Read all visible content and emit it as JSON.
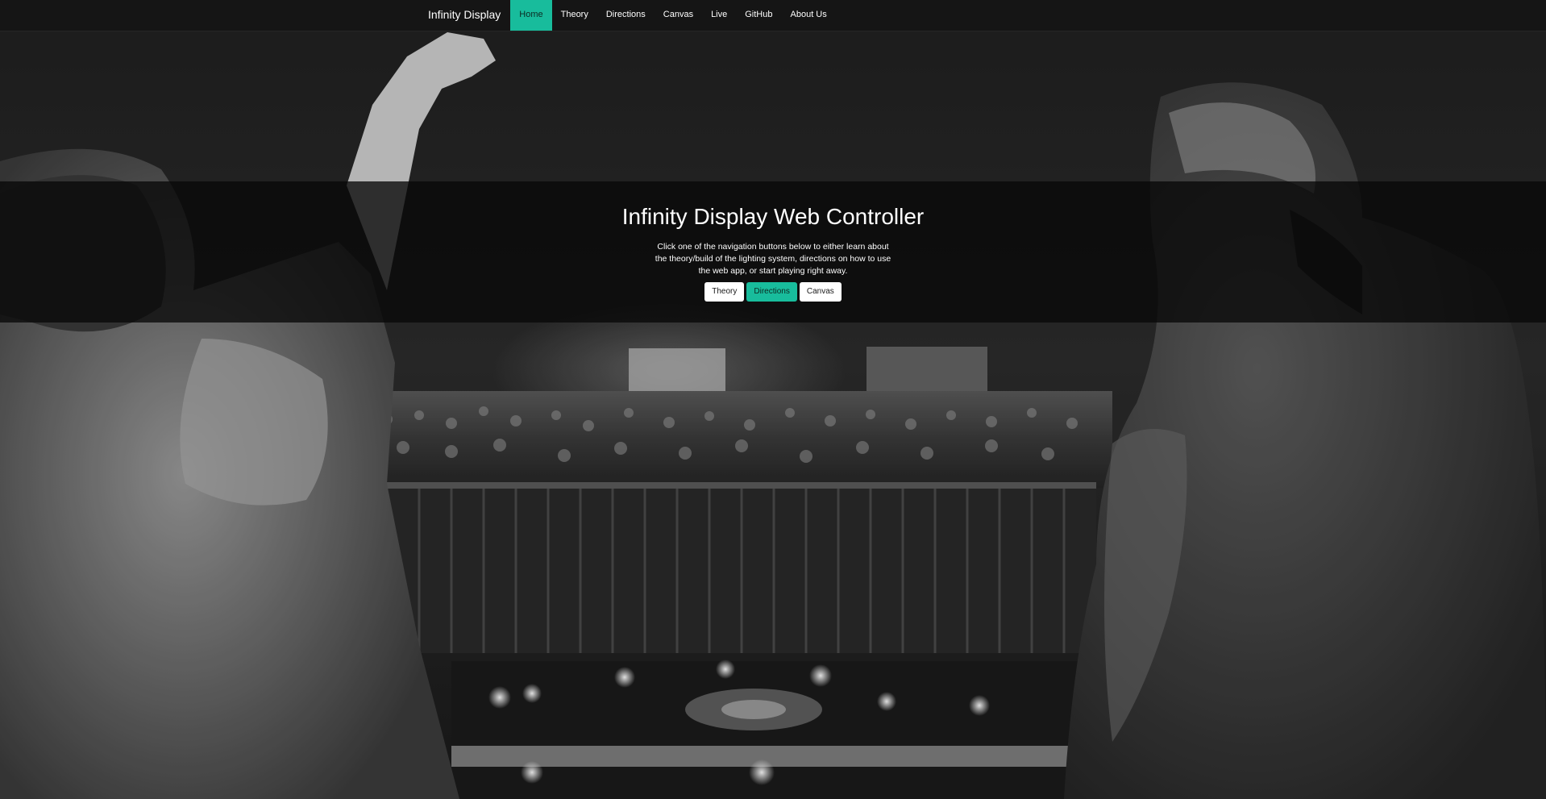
{
  "colors": {
    "accent": "#18bc9c",
    "navbar_bg": "#151515",
    "band_bg": "rgba(8,8,8,0.78)"
  },
  "navbar": {
    "brand": "Infinity Display",
    "items": [
      {
        "label": "Home",
        "active": true
      },
      {
        "label": "Theory",
        "active": false
      },
      {
        "label": "Directions",
        "active": false
      },
      {
        "label": "Canvas",
        "active": false
      },
      {
        "label": "Live",
        "active": false
      },
      {
        "label": "GitHub",
        "active": false
      },
      {
        "label": "About Us",
        "active": false
      }
    ]
  },
  "hero": {
    "title": "Infinity Display Web Controller",
    "text": "Click one of the navigation buttons below to either learn about the theory/build of the lighting system, directions on how to use the web app, or start playing right away.",
    "buttons": [
      {
        "label": "Theory",
        "style": "default"
      },
      {
        "label": "Directions",
        "style": "primary"
      },
      {
        "label": "Canvas",
        "style": "default"
      }
    ]
  }
}
